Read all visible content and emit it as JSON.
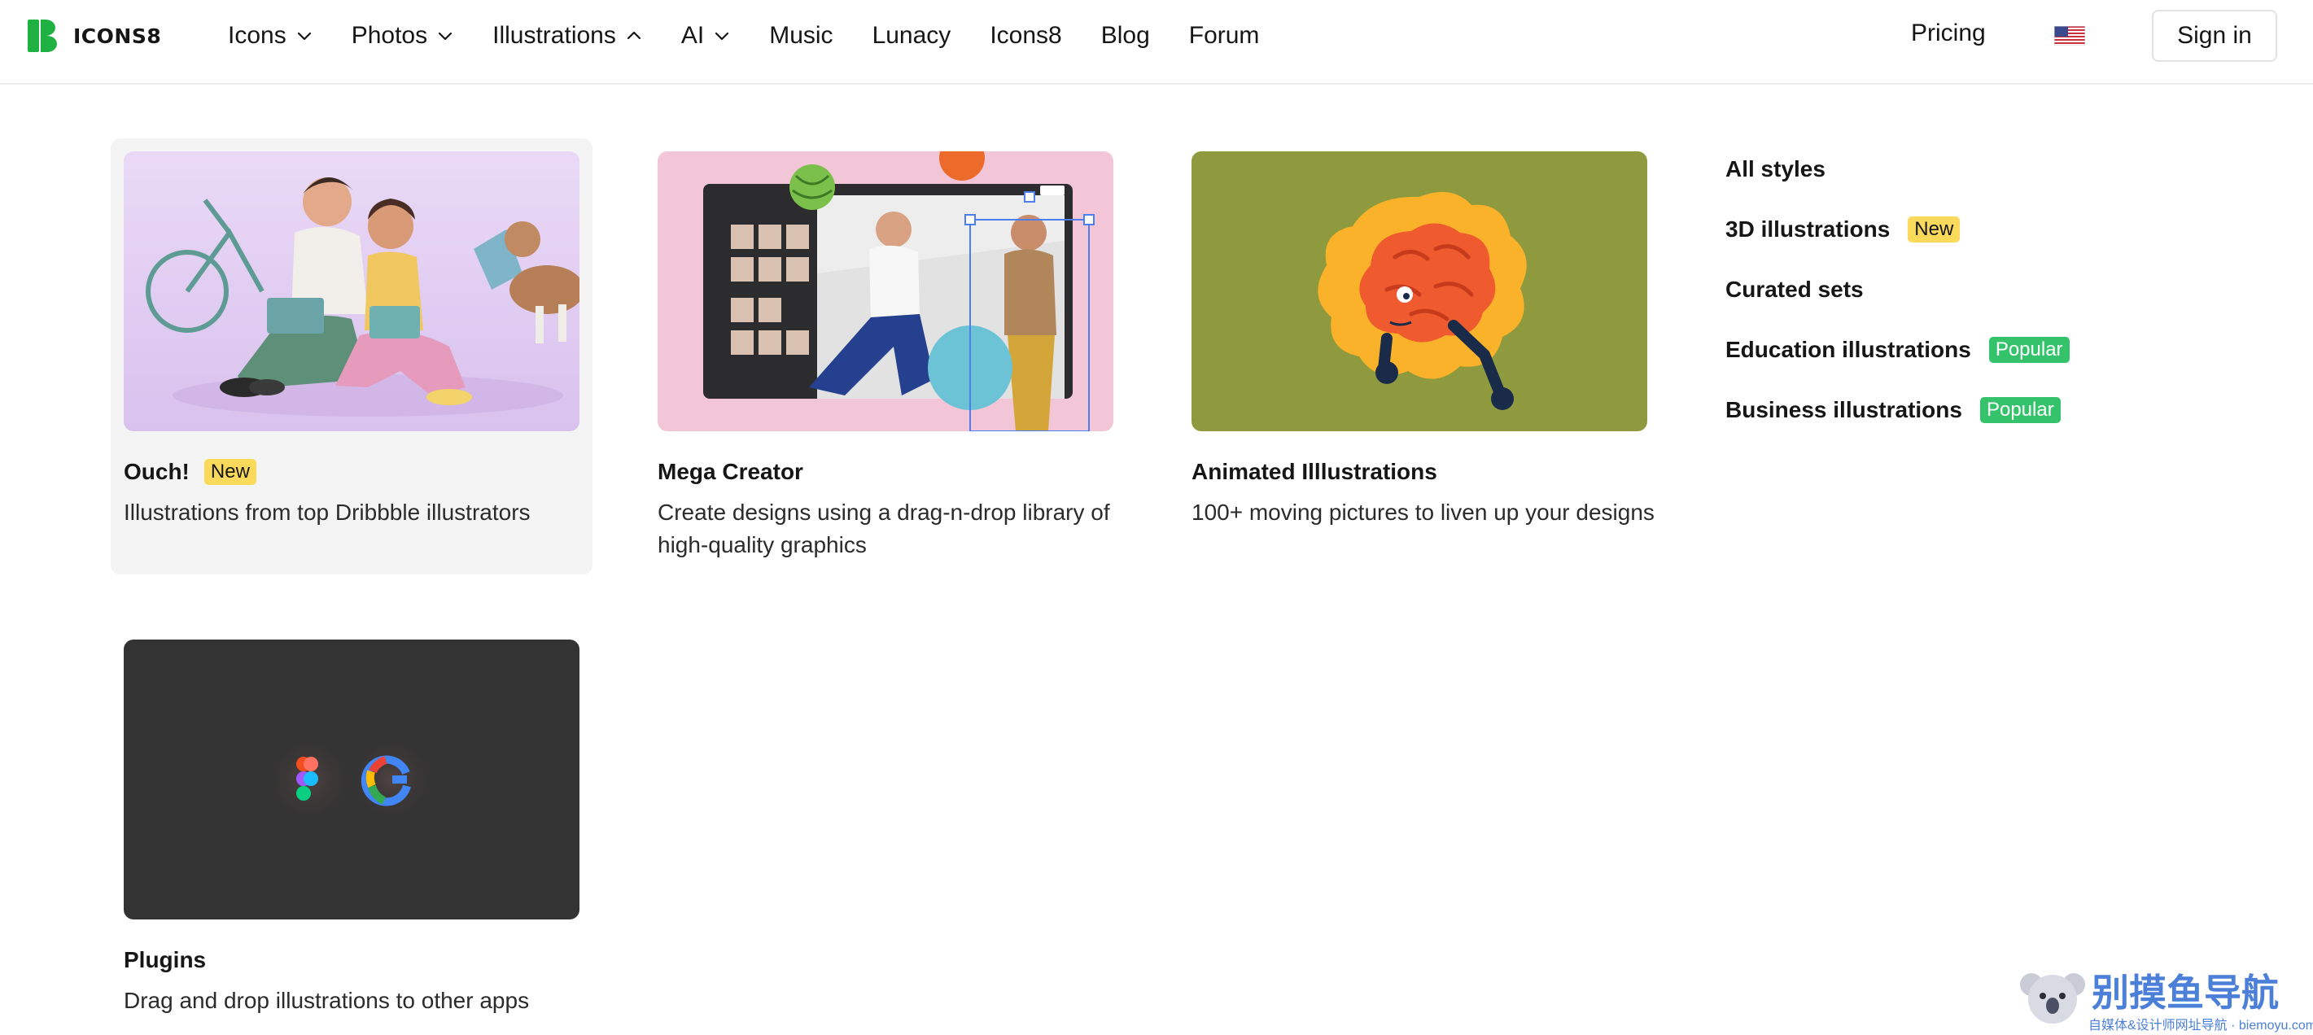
{
  "brand": {
    "name": "ICONS8",
    "color": "#1fb141"
  },
  "nav": {
    "items": [
      {
        "label": "Icons",
        "chevron": "chevron-down-icon"
      },
      {
        "label": "Photos",
        "chevron": "chevron-down-icon"
      },
      {
        "label": "Illustrations",
        "chevron": "chevron-up-icon"
      },
      {
        "label": "AI",
        "chevron": "chevron-down-icon"
      },
      {
        "label": "Music"
      },
      {
        "label": "Lunacy"
      },
      {
        "label": "Icons8"
      },
      {
        "label": "Blog"
      },
      {
        "label": "Forum"
      }
    ],
    "pricing": "Pricing",
    "flag_icon": "us-flag-icon",
    "signin": "Sign in"
  },
  "cards": [
    {
      "title": "Ouch!",
      "badge": "New",
      "desc": "Illustrations from top Dribbble illustrators",
      "image_bg": "#e7d6f3"
    },
    {
      "title": "Mega Creator",
      "desc": "Create designs using a drag-n-drop library of high-quality graphics",
      "image_bg": "#f3c6d8"
    },
    {
      "title": "Animated Illlustrations",
      "desc": "100+ moving pictures to liven up your designs",
      "image_bg": "#8f9a3f"
    },
    {
      "title": "Plugins",
      "desc": "Drag and drop illustrations to other apps",
      "image_bg": "#333333"
    }
  ],
  "styles": [
    {
      "label": "All styles"
    },
    {
      "label": "3D illustrations",
      "badge": "New"
    },
    {
      "label": "Curated sets"
    },
    {
      "label": "Education illustrations",
      "badge": "Popular"
    },
    {
      "label": "Business illustrations",
      "badge": "Popular"
    }
  ],
  "colors": {
    "badge_new": "#fbd95a",
    "badge_popular": "#34c36b",
    "active_card_bg": "#f4f4f4"
  },
  "watermark": {
    "title": "别摸鱼导航",
    "sub": "自媒体&设计师网址导航 · biemoyu.com"
  }
}
